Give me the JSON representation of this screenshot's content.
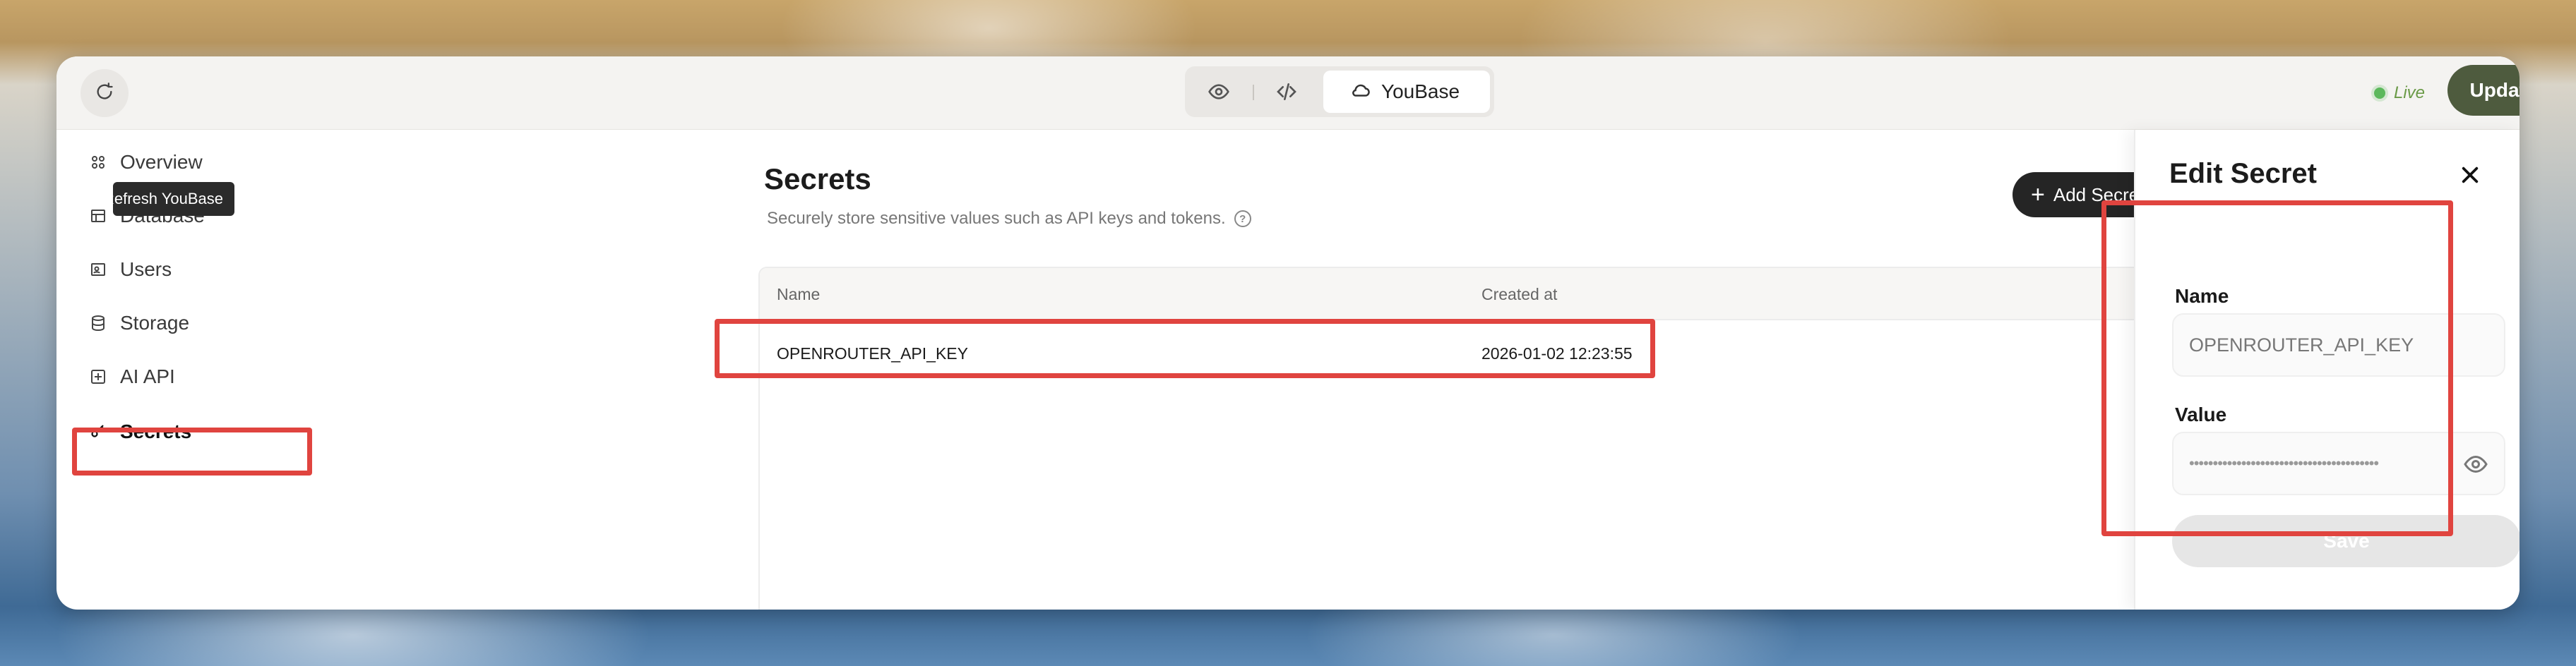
{
  "topbar": {
    "refresh_tooltip": "Refresh YouBase",
    "active_view": "YouBase",
    "status": "Live",
    "update_label": "Update"
  },
  "sidebar": {
    "items": [
      {
        "label": "Overview",
        "icon": "grid-icon"
      },
      {
        "label": "Database",
        "icon": "table-icon"
      },
      {
        "label": "Users",
        "icon": "user-card-icon"
      },
      {
        "label": "Storage",
        "icon": "storage-icon"
      },
      {
        "label": "AI API",
        "icon": "sparkle-box-icon"
      },
      {
        "label": "Secrets",
        "icon": "key-icon"
      }
    ],
    "active": "Secrets"
  },
  "main": {
    "title": "Secrets",
    "subtitle": "Securely store sensitive values such as API keys and tokens.",
    "add_label": "Add Secret",
    "table": {
      "columns": [
        "Name",
        "Created at"
      ],
      "rows": [
        {
          "name": "OPENROUTER_API_KEY",
          "created_at": "2026-01-02 12:23:55"
        }
      ]
    }
  },
  "edit_panel": {
    "title": "Edit Secret",
    "name_label": "Name",
    "name_value": "OPENROUTER_API_KEY",
    "value_label": "Value",
    "value_masked": "••••••••••••••••••••••••••••••••••••••••",
    "save_label": "Save"
  },
  "colors": {
    "accent": "#4e5b3e",
    "highlight": "#e0443f",
    "live": "#5cb85c"
  }
}
